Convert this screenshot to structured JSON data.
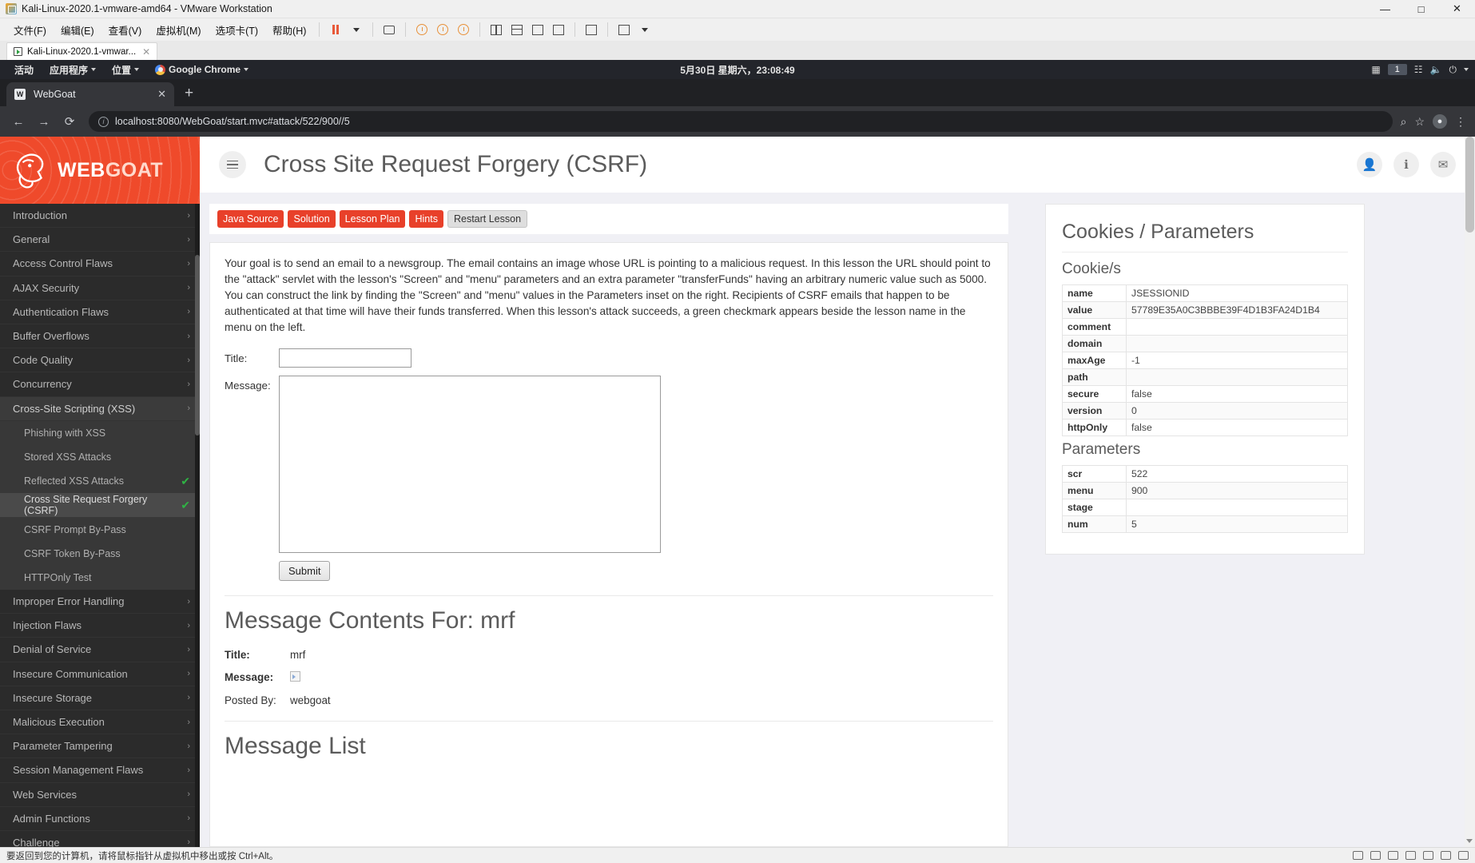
{
  "vmware": {
    "title": "Kali-Linux-2020.1-vmware-amd64 - VMware Workstation",
    "menu": [
      "文件(F)",
      "编辑(E)",
      "查看(V)",
      "虚拟机(M)",
      "选项卡(T)",
      "帮助(H)"
    ],
    "tab_label": "Kali-Linux-2020.1-vmwar...",
    "minimize": "—",
    "maximize": "□",
    "close": "✕",
    "status_text": "要返回到您的计算机，请将鼠标指针从虚拟机中移出或按 Ctrl+Alt。"
  },
  "gnome": {
    "activities": "活动",
    "applications": "应用程序",
    "places": "位置",
    "app_name": "Google Chrome",
    "clock": "5月30日 星期六，23:08:49",
    "workspace": "1"
  },
  "chrome": {
    "tab_title": "WebGoat",
    "tab_favicon": "W",
    "new_tab": "+",
    "close_tab": "✕",
    "back": "←",
    "forward": "→",
    "reload": "⟳",
    "url": "localhost:8080/WebGoat/start.mvc#attack/522/900//5",
    "zoom_icon": "⌕",
    "star_icon": "☆",
    "profile_icon": "●",
    "menu_icon": "⋮"
  },
  "webgoat": {
    "brand_part1": "WEB",
    "brand_part2": "GOAT",
    "page_title": "Cross Site Request Forgery (CSRF)",
    "header_icons": [
      "user-icon",
      "info-icon",
      "mail-icon"
    ],
    "menu": [
      {
        "label": "Introduction",
        "type": "category",
        "chevron": "›"
      },
      {
        "label": "General",
        "type": "category",
        "chevron": "›"
      },
      {
        "label": "Access Control Flaws",
        "type": "category",
        "chevron": "›"
      },
      {
        "label": "AJAX Security",
        "type": "category",
        "chevron": "›"
      },
      {
        "label": "Authentication Flaws",
        "type": "category",
        "chevron": "›"
      },
      {
        "label": "Buffer Overflows",
        "type": "category",
        "chevron": "›"
      },
      {
        "label": "Code Quality",
        "type": "category",
        "chevron": "›"
      },
      {
        "label": "Concurrency",
        "type": "category",
        "chevron": "›"
      },
      {
        "label": "Cross-Site Scripting (XSS)",
        "type": "category-open",
        "chevron": "›"
      },
      {
        "label": "Phishing with XSS",
        "type": "sub"
      },
      {
        "label": "Stored XSS Attacks",
        "type": "sub"
      },
      {
        "label": "Reflected XSS Attacks",
        "type": "sub",
        "completed": "✔"
      },
      {
        "label": "Cross Site Request Forgery (CSRF)",
        "type": "sub-selected",
        "completed": "✔"
      },
      {
        "label": "CSRF Prompt By-Pass",
        "type": "sub"
      },
      {
        "label": "CSRF Token By-Pass",
        "type": "sub"
      },
      {
        "label": "HTTPOnly Test",
        "type": "sub"
      },
      {
        "label": "Improper Error Handling",
        "type": "category",
        "chevron": "›"
      },
      {
        "label": "Injection Flaws",
        "type": "category",
        "chevron": "›"
      },
      {
        "label": "Denial of Service",
        "type": "category",
        "chevron": "›"
      },
      {
        "label": "Insecure Communication",
        "type": "category",
        "chevron": "›"
      },
      {
        "label": "Insecure Storage",
        "type": "category",
        "chevron": "›"
      },
      {
        "label": "Malicious Execution",
        "type": "category",
        "chevron": "›"
      },
      {
        "label": "Parameter Tampering",
        "type": "category",
        "chevron": "›"
      },
      {
        "label": "Session Management Flaws",
        "type": "category",
        "chevron": "›"
      },
      {
        "label": "Web Services",
        "type": "category",
        "chevron": "›"
      },
      {
        "label": "Admin Functions",
        "type": "category",
        "chevron": "›"
      },
      {
        "label": "Challenge",
        "type": "category",
        "chevron": "›"
      }
    ],
    "lesson_buttons": [
      {
        "label": "Java Source",
        "style": "red"
      },
      {
        "label": "Solution",
        "style": "red"
      },
      {
        "label": "Lesson Plan",
        "style": "red"
      },
      {
        "label": "Hints",
        "style": "red"
      },
      {
        "label": "Restart Lesson",
        "style": "grey"
      }
    ],
    "lesson_text": "Your goal is to send an email to a newsgroup. The email contains an image whose URL is pointing to a malicious request. In this lesson the URL should point to the \"attack\" servlet with the lesson's \"Screen\" and \"menu\" parameters and an extra parameter \"transferFunds\" having an arbitrary numeric value such as 5000. You can construct the link by finding the \"Screen\" and \"menu\" values in the Parameters inset on the right. Recipients of CSRF emails that happen to be authenticated at that time will have their funds transferred. When this lesson's attack succeeds, a green checkmark appears beside the lesson name in the menu on the left.",
    "form": {
      "title_label": "Title:",
      "title_value": "",
      "title_placeholder": "",
      "message_label": "Message:",
      "message_value": "",
      "message_placeholder": "",
      "submit_label": "Submit"
    },
    "message_contents": {
      "heading": "Message Contents For: mrf",
      "title_label": "Title:",
      "title_value": "mrf",
      "message_label": "Message:",
      "message_value": "broken-image-icon",
      "posted_by_label": "Posted By:",
      "posted_by_value": "webgoat"
    },
    "message_list_heading": "Message List"
  },
  "rail": {
    "heading": "Cookies / Parameters",
    "cookies_heading": "Cookie/s",
    "cookies": [
      {
        "key": "name",
        "value": "JSESSIONID"
      },
      {
        "key": "value",
        "value": "57789E35A0C3BBBE39F4D1B3FA24D1B4"
      },
      {
        "key": "comment",
        "value": ""
      },
      {
        "key": "domain",
        "value": ""
      },
      {
        "key": "maxAge",
        "value": "-1"
      },
      {
        "key": "path",
        "value": ""
      },
      {
        "key": "secure",
        "value": "false"
      },
      {
        "key": "version",
        "value": "0"
      },
      {
        "key": "httpOnly",
        "value": "false"
      }
    ],
    "parameters_heading": "Parameters",
    "parameters": [
      {
        "key": "scr",
        "value": "522"
      },
      {
        "key": "menu",
        "value": "900"
      },
      {
        "key": "stage",
        "value": ""
      },
      {
        "key": "num",
        "value": "5"
      }
    ]
  },
  "colors": {
    "webgoat_red": "#ef4a2b",
    "sidebar_bg": "#282828",
    "check_green": "#2fb344"
  }
}
